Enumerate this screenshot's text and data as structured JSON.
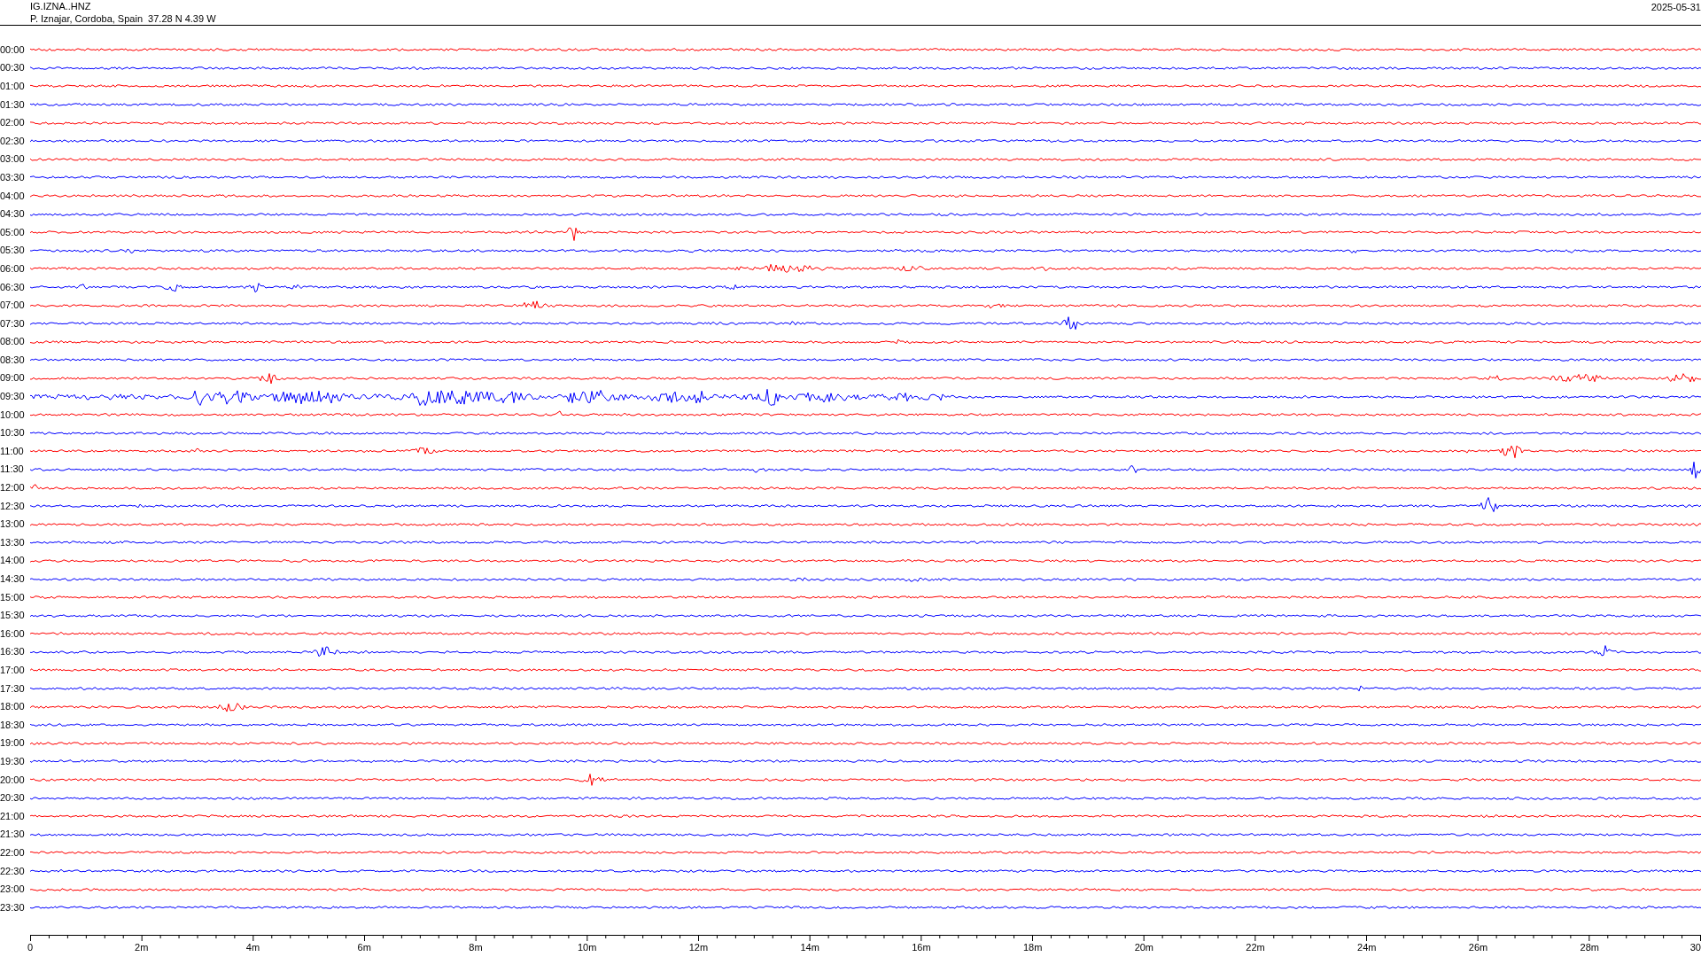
{
  "header": {
    "channel": "IG.IZNA..HNZ",
    "station": "P. Iznajar, Cordoba, Spain  37.28 N 4.39 W",
    "date": "2025-05-31"
  },
  "traces": [
    {
      "time": "00:00",
      "color": "#ff0000"
    },
    {
      "time": "00:30",
      "color": "#0000ff"
    },
    {
      "time": "01:00",
      "color": "#ff0000"
    },
    {
      "time": "01:30",
      "color": "#0000ff"
    },
    {
      "time": "02:00",
      "color": "#ff0000"
    },
    {
      "time": "02:30",
      "color": "#0000ff"
    },
    {
      "time": "03:00",
      "color": "#ff0000"
    },
    {
      "time": "03:30",
      "color": "#0000ff"
    },
    {
      "time": "04:00",
      "color": "#ff0000"
    },
    {
      "time": "04:30",
      "color": "#0000ff"
    },
    {
      "time": "05:00",
      "color": "#ff0000"
    },
    {
      "time": "05:30",
      "color": "#0000ff"
    },
    {
      "time": "06:00",
      "color": "#ff0000"
    },
    {
      "time": "06:30",
      "color": "#0000ff"
    },
    {
      "time": "07:00",
      "color": "#ff0000"
    },
    {
      "time": "07:30",
      "color": "#0000ff"
    },
    {
      "time": "08:00",
      "color": "#ff0000"
    },
    {
      "time": "08:30",
      "color": "#0000ff"
    },
    {
      "time": "09:00",
      "color": "#ff0000"
    },
    {
      "time": "09:30",
      "color": "#0000ff"
    },
    {
      "time": "10:00",
      "color": "#ff0000"
    },
    {
      "time": "10:30",
      "color": "#0000ff"
    },
    {
      "time": "11:00",
      "color": "#ff0000"
    },
    {
      "time": "11:30",
      "color": "#0000ff"
    },
    {
      "time": "12:00",
      "color": "#ff0000"
    },
    {
      "time": "12:30",
      "color": "#0000ff"
    },
    {
      "time": "13:00",
      "color": "#ff0000"
    },
    {
      "time": "13:30",
      "color": "#0000ff"
    },
    {
      "time": "14:00",
      "color": "#ff0000"
    },
    {
      "time": "14:30",
      "color": "#0000ff"
    },
    {
      "time": "15:00",
      "color": "#ff0000"
    },
    {
      "time": "15:30",
      "color": "#0000ff"
    },
    {
      "time": "16:00",
      "color": "#ff0000"
    },
    {
      "time": "16:30",
      "color": "#0000ff"
    },
    {
      "time": "17:00",
      "color": "#ff0000"
    },
    {
      "time": "17:30",
      "color": "#0000ff"
    },
    {
      "time": "18:00",
      "color": "#ff0000"
    },
    {
      "time": "18:30",
      "color": "#0000ff"
    },
    {
      "time": "19:00",
      "color": "#ff0000"
    },
    {
      "time": "19:30",
      "color": "#0000ff"
    },
    {
      "time": "20:00",
      "color": "#ff0000"
    },
    {
      "time": "20:30",
      "color": "#0000ff"
    },
    {
      "time": "21:00",
      "color": "#ff0000"
    },
    {
      "time": "21:30",
      "color": "#0000ff"
    },
    {
      "time": "22:00",
      "color": "#ff0000"
    },
    {
      "time": "22:30",
      "color": "#0000ff"
    },
    {
      "time": "23:00",
      "color": "#ff0000"
    },
    {
      "time": "23:30",
      "color": "#0000ff"
    }
  ],
  "time_axis": {
    "ticks": [
      "0",
      "2m",
      "4m",
      "6m",
      "8m",
      "10m",
      "12m",
      "14m",
      "16m",
      "18m",
      "20m",
      "22m",
      "24m",
      "26m",
      "28m",
      "30"
    ]
  }
}
